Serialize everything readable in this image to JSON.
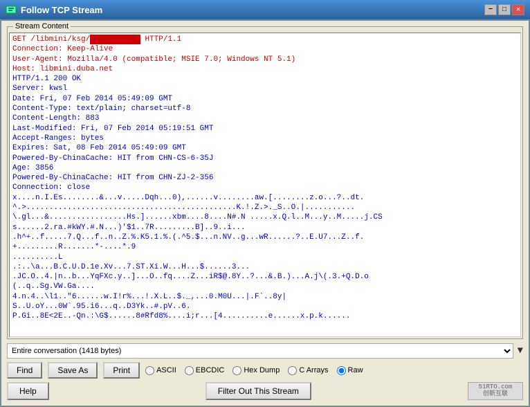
{
  "window": {
    "title": "Follow TCP Stream",
    "title_icon": "tcp-icon"
  },
  "title_buttons": {
    "minimize": "−",
    "maximize": "□",
    "close": "✕"
  },
  "stream_group": {
    "label": "Stream Content"
  },
  "stream_content": {
    "lines": [
      {
        "text": "GET /libmini/ksg/",
        "color": "red",
        "redact": true,
        "suffix": " HTTP/1.1"
      },
      {
        "text": "Connection: Keep-Alive",
        "color": "red"
      },
      {
        "text": "User-Agent: Mozilla/4.0 (compatible; MSIE 7.0; Windows NT 5.1)",
        "color": "red"
      },
      {
        "text": "Host: libmini.duba.net",
        "color": "red"
      },
      {
        "text": "",
        "color": "red"
      },
      {
        "text": "HTTP/1.1 200 OK",
        "color": "blue"
      },
      {
        "text": "Server: kwsl",
        "color": "blue"
      },
      {
        "text": "Date: Fri, 07 Feb 2014 05:49:09 GMT",
        "color": "blue"
      },
      {
        "text": "Content-Type: text/plain; charset=utf-8",
        "color": "blue"
      },
      {
        "text": "Content-Length: 883",
        "color": "blue"
      },
      {
        "text": "Last-Modified: Fri, 07 Feb 2014 05:19:51 GMT",
        "color": "blue"
      },
      {
        "text": "Accept-Ranges: bytes",
        "color": "blue"
      },
      {
        "text": "Expires: Sat, 08 Feb 2014 05:49:09 GMT",
        "color": "blue"
      },
      {
        "text": "Powered-By-ChinaCache: HIT from CHN-CS-6-35J",
        "color": "blue"
      },
      {
        "text": "Age: 3856",
        "color": "blue"
      },
      {
        "text": "Powered-By-ChinaCache: HIT from CHN-ZJ-2-356",
        "color": "blue"
      },
      {
        "text": "Connection: close",
        "color": "blue"
      },
      {
        "text": "",
        "color": "blue"
      },
      {
        "text": "x....n.I.Es........&...v.....Dqh...0),......v........aw.[........z.o...?..dt.",
        "color": "blue"
      },
      {
        "text": "^.>..............................................K.!.Z.>._S..O.|...........",
        "color": "blue"
      },
      {
        "text": "\\.gl...&.................Hs.]......xbm....8....N#.N .....x.Q.l..M...y..M.....j.CS",
        "color": "blue"
      },
      {
        "text": "s......2.ra.#kWY.#.N...)'$1..7R.........B]..9..i...",
        "color": "blue"
      },
      {
        "text": ".h^+..f.....7.Q...f..n..Z.%.K5.1.%.(.^5.$...n.NV..g...wR......?..E.U7...Z..f.",
        "color": "blue"
      },
      {
        "text": "+.........R.......*-....*.9",
        "color": "blue"
      },
      {
        "text": "..........L",
        "color": "blue"
      },
      {
        "text": ".:..\\a...B.C.U.D.1e.Xv...7.ST.Xi.W...H...$......3...",
        "color": "blue"
      },
      {
        "text": ".JC.O..4.|n..b...YqFXc.y..]...O..fq....Z...iR$@.8Y..?...&.B.)...A.j\\(.3.+Q.D.o",
        "color": "blue"
      },
      {
        "text": "(..q..Sg.VW.Ga....",
        "color": "blue"
      },
      {
        "text": "4.n.4..\\l1..\"6......w.I!r%...!.X.L..$._,...0.M0U...|.F`..8y|",
        "color": "blue"
      },
      {
        "text": "S..U.oY...0W`.95.i6...q..D3Yk..#.pV..6.",
        "color": "blue"
      },
      {
        "text": "P.Gi..8E<2E..-Qn.:\\G$......8#Rfd8%....i;r...[4..........e......x.p.k......",
        "color": "blue"
      }
    ]
  },
  "conversation": {
    "label": "Entire conversation (1418 bytes)",
    "dropdown_arrow": "▼"
  },
  "buttons": {
    "find": "Find",
    "save_as": "Save As",
    "print": "Print",
    "help": "Help",
    "filter": "Filter Out This Stream"
  },
  "radio_options": [
    {
      "id": "ascii",
      "label": "ASCII",
      "checked": false
    },
    {
      "id": "ebcdic",
      "label": "EBCDIC",
      "checked": false
    },
    {
      "id": "hex_dump",
      "label": "Hex Dump",
      "checked": false
    },
    {
      "id": "c_arrays",
      "label": "C Arrays",
      "checked": false
    },
    {
      "id": "raw",
      "label": "Raw",
      "checked": true
    }
  ],
  "watermark": {
    "line1": "51RTO.com",
    "line2": "创新互联"
  }
}
